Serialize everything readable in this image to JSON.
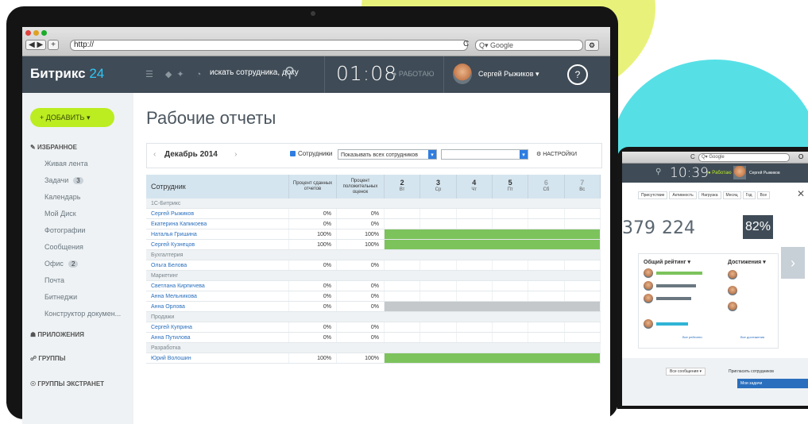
{
  "browser": {
    "url": "http://",
    "search_placeholder": "Q▾ Google",
    "nav_back": "◀ ▶",
    "nav_add": "+",
    "refresh": "C",
    "bookmark": "⚙"
  },
  "app": {
    "logo_text": "Битрикс",
    "logo_num": "24",
    "search_text": "искать сотрудника, доку",
    "clock": "01:08",
    "status": "● РАБОТАЮ",
    "user_name": "Сергей Рыжиков ▾",
    "help": "?"
  },
  "sidebar": {
    "add_button": "+ ДОБАВИТЬ ▾",
    "section_favorites": "ИЗБРАННОЕ",
    "items": [
      {
        "label": "Живая лента",
        "badge": ""
      },
      {
        "label": "Задачи",
        "badge": "3"
      },
      {
        "label": "Календарь",
        "badge": ""
      },
      {
        "label": "Мой Диск",
        "badge": ""
      },
      {
        "label": "Фотографии",
        "badge": ""
      },
      {
        "label": "Сообщения",
        "badge": ""
      },
      {
        "label": "Офис",
        "badge": "2"
      },
      {
        "label": "Почта",
        "badge": ""
      },
      {
        "label": "Битнеджи",
        "badge": ""
      },
      {
        "label": "Конструктор докумен...",
        "badge": ""
      }
    ],
    "section_apps": "ПРИЛОЖЕНИЯ",
    "section_groups": "ГРУППЫ",
    "section_extranet": "ГРУППЫ ЭКСТРАНЕТ"
  },
  "main": {
    "title": "Рабочие отчеты",
    "month": "Декабрь 2014",
    "prev": "‹",
    "next": "› ›",
    "checkbox_label": "Сотрудники",
    "select1": "Показывать всех сотрудников",
    "select2": "",
    "settings": "НАСТРОЙКИ",
    "table": {
      "col_employee": "Сотрудник",
      "col_pct1": "Процент сданных отчетов",
      "col_pct2": "Процент положительных оценок",
      "days": [
        {
          "num": "2",
          "wd": "Вт",
          "weekend": false
        },
        {
          "num": "3",
          "wd": "Ср",
          "weekend": false
        },
        {
          "num": "4",
          "wd": "Чт",
          "weekend": false
        },
        {
          "num": "5",
          "wd": "Пт",
          "weekend": false
        },
        {
          "num": "6",
          "wd": "Сб",
          "weekend": true
        },
        {
          "num": "7",
          "wd": "Вс",
          "weekend": true
        }
      ],
      "rows": [
        {
          "type": "group",
          "name": "1С-Битрикс"
        },
        {
          "type": "emp",
          "name": "Сергей Рыжиков",
          "p1": "0%",
          "p2": "0%",
          "bar": ""
        },
        {
          "type": "emp",
          "name": "Екатерина Капикоева",
          "p1": "0%",
          "p2": "0%",
          "bar": ""
        },
        {
          "type": "emp",
          "name": "Наталья Гришина",
          "p1": "100%",
          "p2": "100%",
          "bar": "green"
        },
        {
          "type": "emp",
          "name": "Сергей Кузнецов",
          "p1": "100%",
          "p2": "100%",
          "bar": "green"
        },
        {
          "type": "group",
          "name": "Бухгалтерия"
        },
        {
          "type": "emp",
          "name": "Ольга Белова",
          "p1": "0%",
          "p2": "0%",
          "bar": ""
        },
        {
          "type": "group",
          "name": "Маркетинг"
        },
        {
          "type": "emp",
          "name": "Светлана Кирпичева",
          "p1": "0%",
          "p2": "0%",
          "bar": ""
        },
        {
          "type": "emp",
          "name": "Анна Мельникова",
          "p1": "0%",
          "p2": "0%",
          "bar": ""
        },
        {
          "type": "emp",
          "name": "Анна Орлова",
          "p1": "0%",
          "p2": "0%",
          "bar": "gray"
        },
        {
          "type": "group",
          "name": "Продажи"
        },
        {
          "type": "emp",
          "name": "Сергей Куприна",
          "p1": "0%",
          "p2": "0%",
          "bar": ""
        },
        {
          "type": "emp",
          "name": "Анна Путилова",
          "p1": "0%",
          "p2": "0%",
          "bar": ""
        },
        {
          "type": "group",
          "name": "Разработка"
        },
        {
          "type": "emp",
          "name": "Юрий Волошин",
          "p1": "100%",
          "p2": "100%",
          "bar": "green"
        }
      ]
    }
  },
  "laptop2": {
    "search_placeholder": "Q▾ Google",
    "refresh": "C",
    "bookmark": "O",
    "clock": "10:39",
    "status": "● Работаю",
    "user_name": "Сергей Рыжиков",
    "tabs": [
      "Присутствие",
      "Активность",
      "Нагрузка",
      "Месяц",
      "Год",
      "Все"
    ],
    "stat1": "379",
    "stat2": "224",
    "percent": "82%",
    "rating_title": "Общий рейтинг ▾",
    "achievements_title": "Достижения ▾",
    "more_ratings": "Все рейтинги",
    "more_achievements": "Все достижения",
    "all_messages": "Все сообщения ▾",
    "invite": "Пригласить сотрудников",
    "my_tasks": "Мои задачи",
    "close": "✕",
    "arrow": "›"
  }
}
